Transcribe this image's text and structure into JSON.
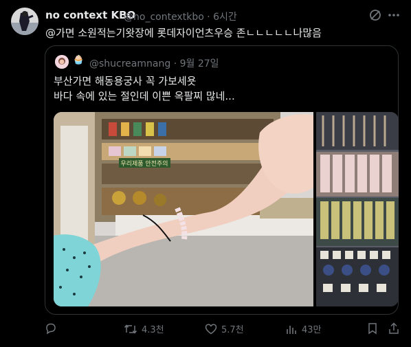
{
  "tweet": {
    "author_name": "no context KBO",
    "author_handle": "@no_contextkbo",
    "separator": "·",
    "time": "6시간",
    "text": "@가면 소원적는기왓장에 롯데자이언츠우승 존ㄴㄴㄴㄴㄴ나많음"
  },
  "quoted": {
    "emoji": "🧁",
    "handle": "@shucreamnang",
    "separator": "·",
    "date": "9월 27일",
    "line1": "부산가면 해동용궁사 꼭 가보세욧",
    "line2": "바다 속에 있는 절인데 이쁜 옥팔찌 많네...",
    "shop_sign": "우리제품 안전주의"
  },
  "actions": {
    "replies": "",
    "retweets": "4.3천",
    "likes": "5.7천",
    "views": "43만"
  },
  "icons": {
    "grok": "grok-icon",
    "more": "more-icon",
    "reply": "reply-icon",
    "retweet": "retweet-icon",
    "like": "like-icon",
    "views": "views-icon",
    "bookmark": "bookmark-icon",
    "share": "share-icon"
  },
  "colors": {
    "background": "#000000",
    "text": "#e7e9ea",
    "muted": "#71767b",
    "border": "#2f3336"
  }
}
